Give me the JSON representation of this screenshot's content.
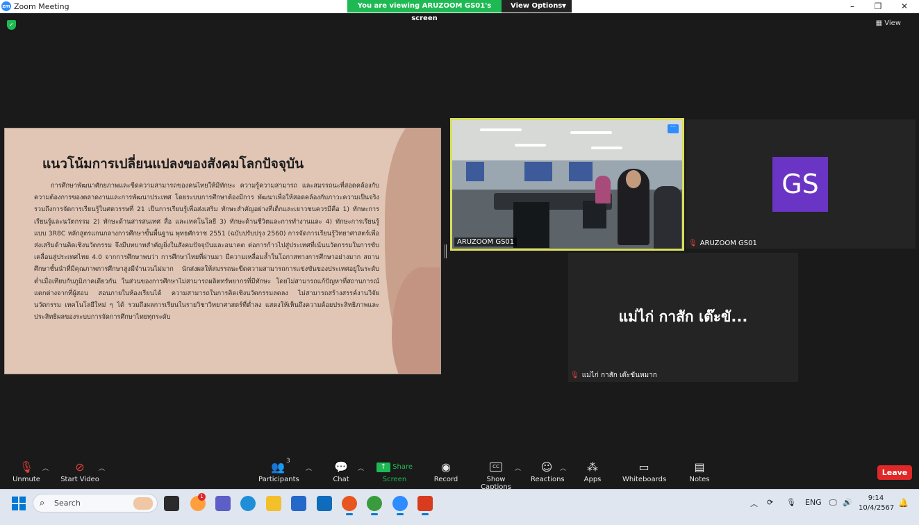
{
  "window": {
    "logo": "zm",
    "title": "Zoom Meeting",
    "minimize": "–",
    "restore": "❐",
    "close": "✕"
  },
  "share_banner": {
    "text": "You are viewing ARUZOOM GS01's screen",
    "view_options": "View Options"
  },
  "top_right": {
    "view_label": "View"
  },
  "slide": {
    "title": "แนวโน้มการเปลี่ยนแปลงของสังคมโลกปัจจุบัน",
    "body": "การศึกษาพัฒนาศักยภาพและขีดความสามารถของคนไทยให้มีทักษะ ความรู้ความสามารถ และสมรรถนะที่สอดคล้องกับความต้องการของตลาดงานและการพัฒนาประเทศ โดยระบบการศึกษาต้องมีการ พัฒนาเพื่อให้สอดคล้องกับภาวะความเป็นจริง รวมถึงการจัดการเรียนรู้ในศตวรรษที่ 21 เป็นการเรียนรู้เพื่อส่งเสริม ทักษะสำคัญอย่างที่เด็กและเยาวชนควรมีคือ 1) ทักษะการเรียนรู้และนวัตกรรม 2) ทักษะด้านสารสนเทศ สื่อ และเทคโนโลยี 3) ทักษะด้านชีวิตและการทำงานและ 4) ทักษะการเรียนรู้แบบ 3R8C หลักสูตรแกนกลางการศึกษาขั้นพื้นฐาน พุทธศักราช 2551 (ฉบับปรับปรุง 2560) การจัดการเรียนรู้วิทยาศาสตร์เพื่อส่งเสริมด้านคิดเชิงนวัตกรรม จึงมีบทบาทสำคัญยิ่งในสังคมปัจจุบันและอนาคต ต่อการก้าวไปสู่ประเทศที่เน้นนวัตกรรมในการขับเคลื่อนสู่ประเทศไทย 4.0 จากการศึกษาพบว่า การศึกษาไทยที่ผ่านมา มีความเหลื่อมล้ำในโอกาสทางการศึกษาอย่างมาก สถานศึกษาชั้นนำที่มีคุณภาพการศึกษาสูงมีจำนวนไม่มาก นักส่งผลให้สมรรถนะขีดความสามารถการแข่งขันของประเทศอยู่ในระดับต่ำเมื่อเทียบกับภูมิภาคเดียวกัน ในส่วนของการศึกษาไม่สามารถผลิตทรัพยากรที่มีทักษะ โดยไม่สามารถแก้ปัญหาที่สถานการณ์แตกต่างจากที่ผู้สอน สอนภายในห้องเรียนได้ ความสามารถในการคิดเชิงนวัตกรรมลดลง ไม่สามารถสร้างสรรค์งานวิจัย นวัตกรรม เทคโนโลยีใหม่ ๆ ได้ รวมถึงผลการเรียนในรายวิชาวิทยาศาสตร์ที่ต่ำลง แสดงให้เห็นถึงความด้อยประสิทธิภาพและประสิทธิผลของระบบการจัดการศึกษาไทยทุกระดับ"
  },
  "participants": {
    "active_video_name": "ARUZOOM GS01",
    "more_icon": "···",
    "gs_avatar": "GS",
    "gs_name": "ARUZOOM GS01",
    "mae_big_name": "แม่ไก่ กาสัก เต๊ะขั...",
    "mae_name": "แม่ไก่ กาสัก เต๊ะขันหมาก"
  },
  "toolbar": {
    "unmute": "Unmute",
    "start_video": "Start Video",
    "participants": "Participants",
    "participants_count": "3",
    "chat": "Chat",
    "share_screen": "Share Screen",
    "record": "Record",
    "show_captions": "Show Captions",
    "cc": "CC",
    "reactions": "Reactions",
    "apps": "Apps",
    "whiteboards": "Whiteboards",
    "notes": "Notes",
    "leave": "Leave"
  },
  "taskbar": {
    "search_placeholder": "Search",
    "notif_count": "1",
    "language": "ENG",
    "time": "9:14",
    "date": "10/4/2567"
  },
  "colors": {
    "share_green": "#1fb954",
    "leave_red": "#e02828",
    "active_border": "#d9e05a",
    "avatar_purple": "#6a35c4",
    "slide_bg": "#e1c6b5"
  }
}
